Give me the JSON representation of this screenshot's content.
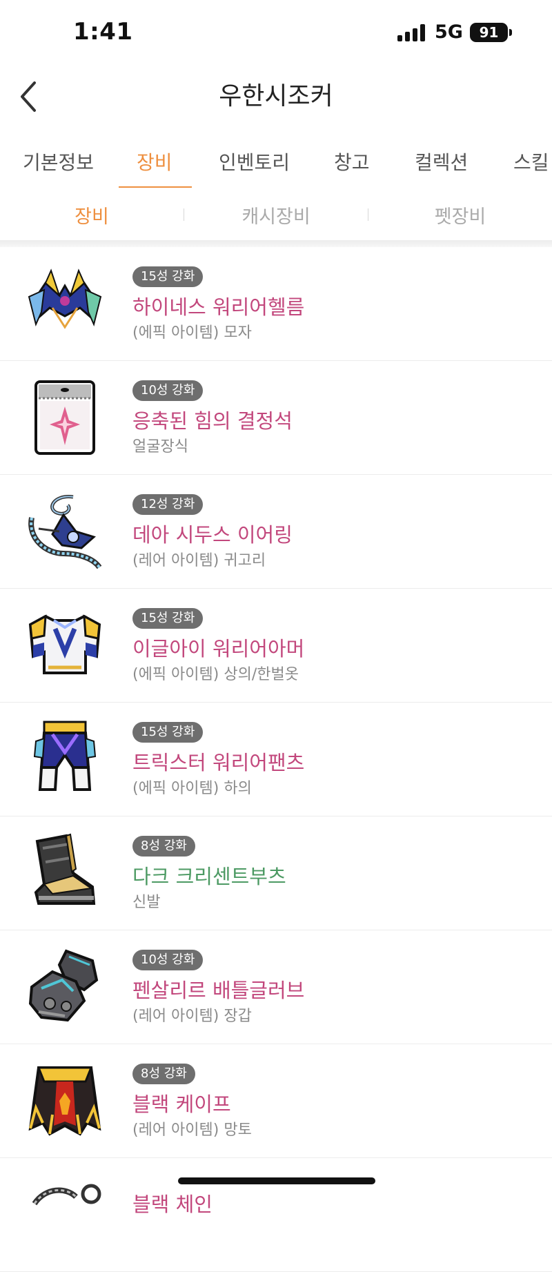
{
  "status_bar": {
    "time": "1:41",
    "network": "5G",
    "battery": "91"
  },
  "header": {
    "title": "우한시조커"
  },
  "tabs": [
    {
      "label": "기본정보"
    },
    {
      "label": "장비"
    },
    {
      "label": "인벤토리"
    },
    {
      "label": "창고"
    },
    {
      "label": "컬렉션"
    },
    {
      "label": "스킬"
    }
  ],
  "active_tab": "장비",
  "subtabs": [
    {
      "label": "장비"
    },
    {
      "label": "캐시장비"
    },
    {
      "label": "펫장비"
    }
  ],
  "active_subtab": "장비",
  "colors": {
    "accent": "#ee8f3f",
    "epic_rare_name": "#c2477c",
    "normal_name": "#4c9a63",
    "badge_bg": "#6e6e6e"
  },
  "items": [
    {
      "badge": "15성 강화",
      "name": "하이네스 워리어헬름",
      "type": "(에픽 아이템) 모자",
      "icon": "helmet-icon"
    },
    {
      "badge": "10성 강화",
      "name": "응축된 힘의 결정석",
      "type": "얼굴장식",
      "icon": "crystal-card-icon"
    },
    {
      "badge": "12성 강화",
      "name": "데아 시두스 이어링",
      "type": "(레어 아이템) 귀고리",
      "icon": "earring-icon"
    },
    {
      "badge": "15성 강화",
      "name": "이글아이 워리어아머",
      "type": "(에픽 아이템) 상의/한벌옷",
      "icon": "armor-icon"
    },
    {
      "badge": "15성 강화",
      "name": "트릭스터 워리어팬츠",
      "type": "(에픽 아이템) 하의",
      "icon": "pants-icon"
    },
    {
      "badge": "8성 강화",
      "name": "다크 크리센트부츠",
      "type": "신발",
      "icon": "boots-icon"
    },
    {
      "badge": "10성 강화",
      "name": "펜살리르 배틀글러브",
      "type": "(레어 아이템) 장갑",
      "icon": "gloves-icon"
    },
    {
      "badge": "8성 강화",
      "name": "블랙 케이프",
      "type": "(레어 아이템) 망토",
      "icon": "cape-icon"
    },
    {
      "badge": "",
      "name": "블랙 체인",
      "type": "",
      "icon": "chain-icon"
    }
  ]
}
